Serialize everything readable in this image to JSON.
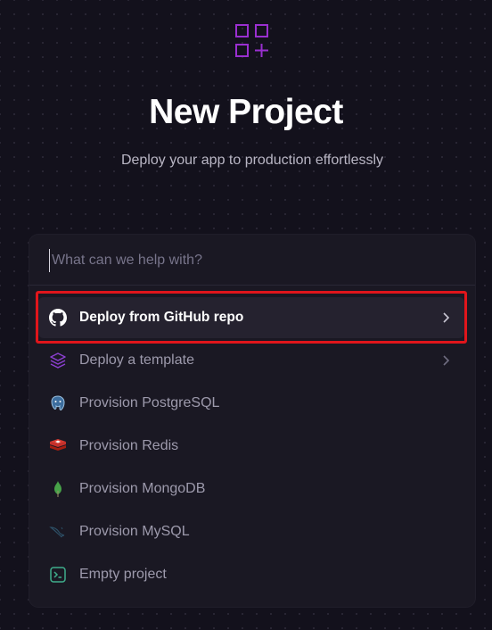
{
  "header": {
    "logo_icon": "grid-plus-icon",
    "title": "New Project",
    "subtitle": "Deploy your app to production effortlessly"
  },
  "search": {
    "placeholder": "What can we help with?",
    "value": ""
  },
  "options": [
    {
      "label": "Deploy from GitHub repo",
      "icon": "github-icon",
      "has_chevron": true,
      "selected": true
    },
    {
      "label": "Deploy a template",
      "icon": "layers-icon",
      "has_chevron": true,
      "selected": false
    },
    {
      "label": "Provision PostgreSQL",
      "icon": "postgresql-icon",
      "has_chevron": false,
      "selected": false
    },
    {
      "label": "Provision Redis",
      "icon": "redis-icon",
      "has_chevron": false,
      "selected": false
    },
    {
      "label": "Provision MongoDB",
      "icon": "mongodb-icon",
      "has_chevron": false,
      "selected": false
    },
    {
      "label": "Provision MySQL",
      "icon": "mysql-icon",
      "has_chevron": false,
      "selected": false
    },
    {
      "label": "Empty project",
      "icon": "terminal-icon",
      "has_chevron": false,
      "selected": false
    }
  ],
  "colors": {
    "background": "#13111c",
    "card": "#1a1823",
    "accent_purple": "#8b2fc9",
    "highlight_red": "#e0151b"
  }
}
